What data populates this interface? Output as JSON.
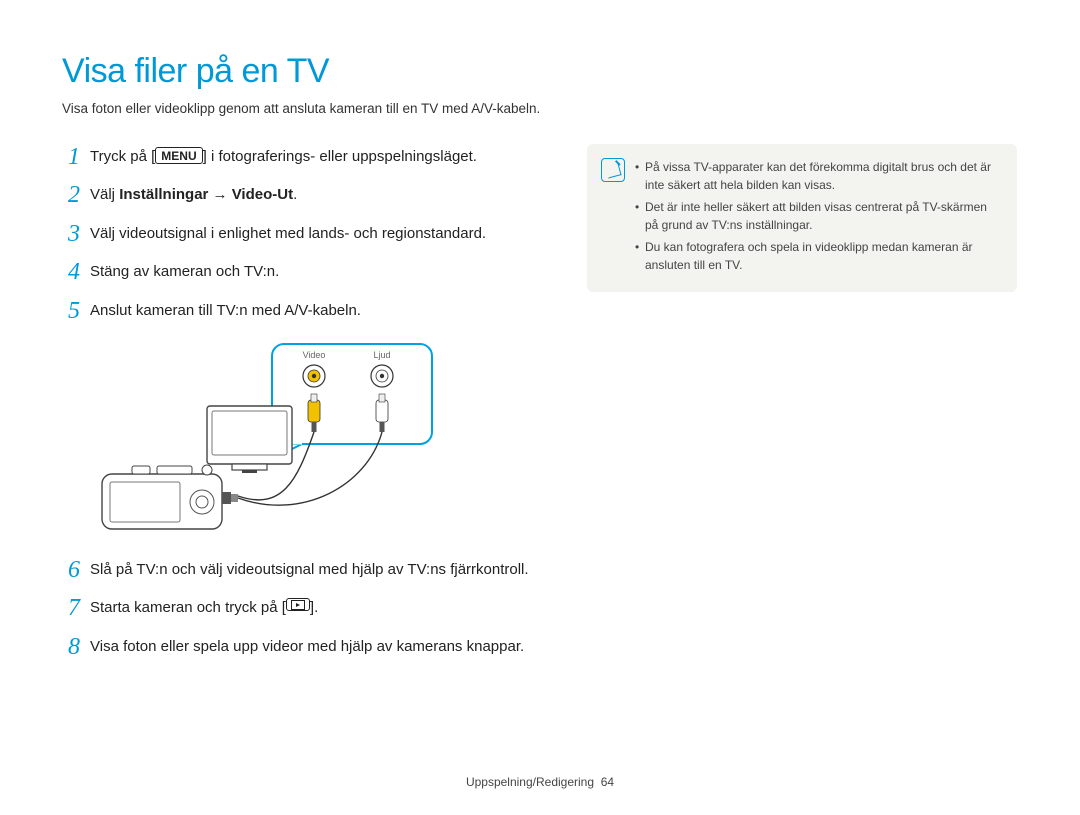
{
  "title": "Visa filer på en TV",
  "subtitle": "Visa foton eller videoklipp genom att ansluta kameran till en TV med A/V-kabeln.",
  "steps": {
    "s1a": "Tryck på [",
    "s1_pill": "MENU",
    "s1b": "] i fotograferings- eller uppspelningsläget.",
    "s2a": "Välj ",
    "s2b": "Inställningar → Video-Ut",
    "s2c": ".",
    "s3": "Välj videoutsignal i enlighet med lands- och regionstandard.",
    "s4": "Stäng av kameran och TV:n.",
    "s5": "Anslut kameran till TV:n med A/V-kabeln.",
    "s6": "Slå på TV:n och välj videoutsignal med hjälp av TV:ns fjärrkontroll.",
    "s7a": "Starta kameran och tryck på [",
    "s7b": "].",
    "s8": "Visa foton eller spela upp videor med hjälp av kamerans knappar."
  },
  "diagram": {
    "label_video": "Video",
    "label_audio": "Ljud"
  },
  "notes": {
    "n1": "På vissa TV-apparater kan det förekomma digitalt brus och det är inte säkert att hela bilden kan visas.",
    "n2": "Det är inte heller säkert att bilden visas centrerat på TV-skärmen på grund av TV:ns inställningar.",
    "n3": "Du kan fotografera och spela in videoklipp medan kameran är ansluten till en TV."
  },
  "footer": {
    "section": "Uppspelning/Redigering",
    "page": "64"
  }
}
